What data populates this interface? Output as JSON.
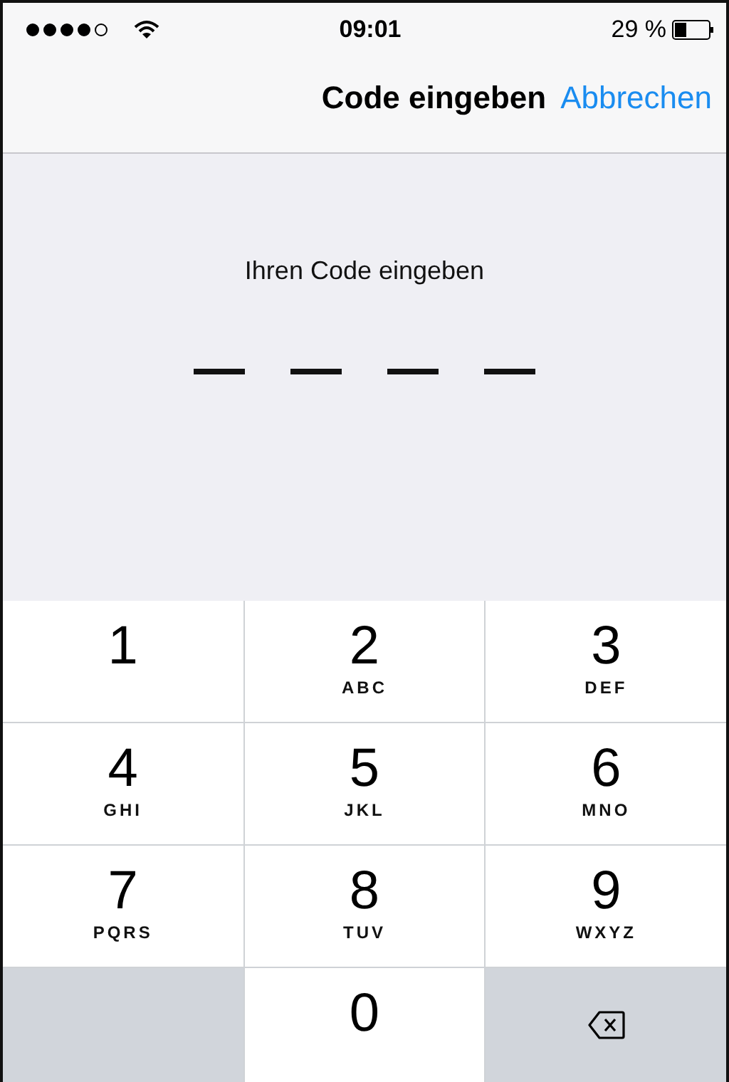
{
  "status_bar": {
    "time": "09:01",
    "battery": "29 %"
  },
  "nav_bar": {
    "title": "Code eingeben",
    "cancel": "Abbrechen"
  },
  "prompt": "Ihren Code eingeben",
  "code_slots": [
    {
      "filled": false
    },
    {
      "filled": false
    },
    {
      "filled": false
    },
    {
      "filled": false
    }
  ],
  "keypad": [
    {
      "kind": "digit",
      "digit": "1"
    },
    {
      "kind": "digit",
      "digit": "2",
      "letters": "ABC"
    },
    {
      "kind": "digit",
      "digit": "3",
      "letters": "DEF"
    },
    {
      "kind": "digit",
      "digit": "4",
      "letters": "GHI"
    },
    {
      "kind": "digit",
      "digit": "5",
      "letters": "JKL"
    },
    {
      "kind": "digit",
      "digit": "6",
      "letters": "MNO"
    },
    {
      "kind": "digit",
      "digit": "7",
      "letters": "PQRS"
    },
    {
      "kind": "digit",
      "digit": "8",
      "letters": "TUV"
    },
    {
      "kind": "digit",
      "digit": "9",
      "letters": "WXYZ"
    },
    {
      "kind": "blank"
    },
    {
      "kind": "digit",
      "digit": "0"
    },
    {
      "kind": "delete"
    }
  ]
}
